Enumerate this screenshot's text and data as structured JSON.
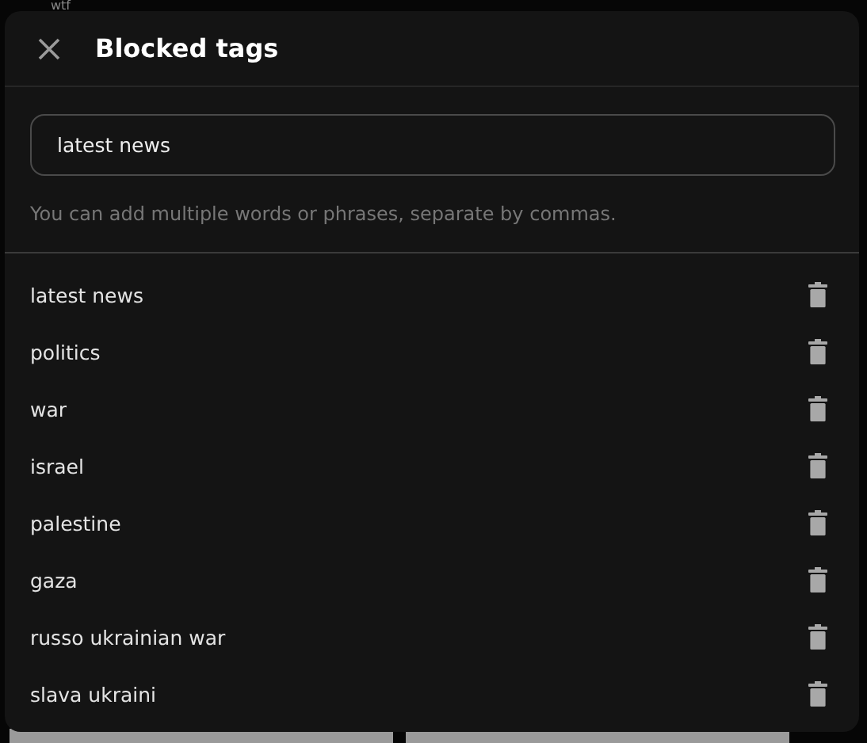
{
  "background": {
    "label": "wtf"
  },
  "dialog": {
    "title": "Blocked tags",
    "input": {
      "value": "latest news"
    },
    "hint": "You can add multiple words or phrases, separate by commas."
  },
  "tags": [
    {
      "label": "latest news"
    },
    {
      "label": "politics"
    },
    {
      "label": "war"
    },
    {
      "label": "israel"
    },
    {
      "label": "palestine"
    },
    {
      "label": "gaza"
    },
    {
      "label": "russo ukrainian war"
    },
    {
      "label": "slava ukraini"
    }
  ]
}
